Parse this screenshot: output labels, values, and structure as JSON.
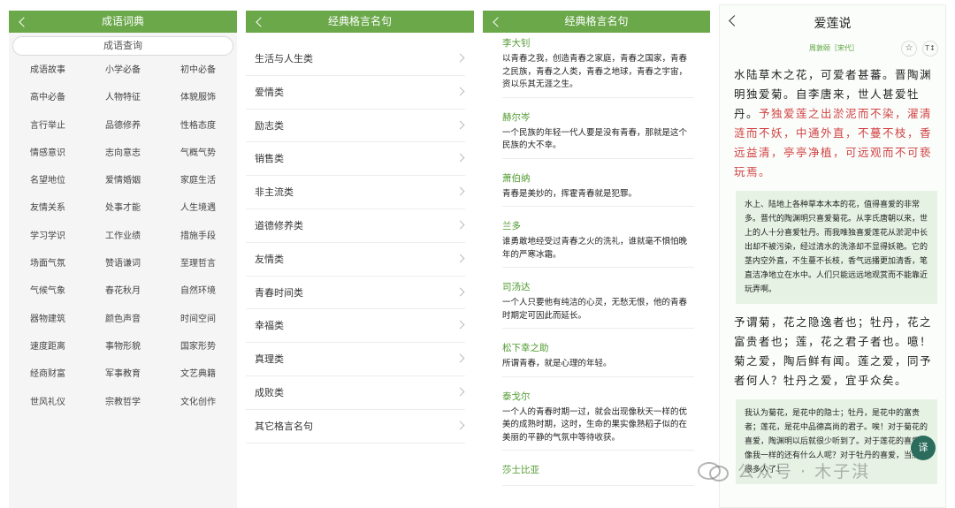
{
  "panel1": {
    "title": "成语词典",
    "search_label": "成语查询",
    "categories": [
      "成语故事",
      "小学必备",
      "初中必备",
      "高中必备",
      "人物特征",
      "体貌服饰",
      "言行举止",
      "品德修养",
      "性格态度",
      "情感意识",
      "志向意志",
      "气概气势",
      "名望地位",
      "爱情婚姻",
      "家庭生活",
      "友情关系",
      "处事才能",
      "人生境遇",
      "学习学识",
      "工作业绩",
      "措施手段",
      "场面气氛",
      "赞语谦词",
      "至理哲言",
      "气候气象",
      "春花秋月",
      "自然环境",
      "器物建筑",
      "颜色声音",
      "时间空间",
      "速度距离",
      "事物形貌",
      "国家形势",
      "经商财富",
      "军事教育",
      "文艺典籍",
      "世风礼仪",
      "宗教哲学",
      "文化创作"
    ]
  },
  "panel2": {
    "title": "经典格言名句",
    "categories": [
      "生活与人生类",
      "爱情类",
      "励志类",
      "销售类",
      "非主流类",
      "道德修养类",
      "友情类",
      "青春时间类",
      "幸福类",
      "真理类",
      "成败类",
      "其它格言名句"
    ]
  },
  "panel3": {
    "title": "经典格言名句",
    "quotes": [
      {
        "author": "李大钊",
        "text": "以青春之我，创造青春之家庭，青春之国家，青春之民族，青春之人类，青春之地球，青春之宇宙，资以乐其无涯之生。"
      },
      {
        "author": "赫尔岑",
        "text": "一个民族的年轻一代人要是没有青春，那就是这个民族的大不幸。"
      },
      {
        "author": "萧伯纳",
        "text": "青春是美妙的，挥霍青春就是犯罪。"
      },
      {
        "author": "兰多",
        "text": "谁勇敢地经受过青春之火的洗礼，谁就毫不惧怕晚年的严寒冰霜。"
      },
      {
        "author": "司汤达",
        "text": "一个人只要他有纯洁的心灵，无愁无恨，他的青春时期定可因此而延长。"
      },
      {
        "author": "松下幸之助",
        "text": "所谓青春，就是心理的年轻。"
      },
      {
        "author": "泰戈尔",
        "text": "一个人的青春时期一过，就会出现像秋天一样的优美的成熟时期，这时，生命的果实像熟稻子似的在美丽的平静的气氛中等待收获。"
      },
      {
        "author": "莎士比亚",
        "text": ""
      }
    ]
  },
  "panel4": {
    "title": "爱莲说",
    "author": "周敦颐［宋代］",
    "star_icon": "star-icon",
    "font_button": "T↕",
    "poem_part1": "水陆草木之花，可爱者甚蕃。晋陶渊明独爱菊。自李唐来，世人甚爱牡丹。",
    "poem_part1_red": "予独爱莲之出淤泥而不染，濯清涟而不妖，中通外直，不蔓不枝，香远益清，亭亭净植，可远观而不可亵玩焉。",
    "translation1": "水上、陆地上各种草本木本的花，值得喜爱的非常多。晋代的陶渊明只喜爱菊花。从李氏唐朝以来，世上的人十分喜爱牡丹。而我唯独喜爱莲花从淤泥中长出却不被污染，经过清水的洗涤却不显得妖艳。它的茎内空外直，不生蔓不长枝，香气远播更加清香，笔直洁净地立在水中。人们只能远远地观赏而不能靠近玩弄啊。",
    "poem_part2": "予谓菊，花之隐逸者也；牡丹，花之富贵者也；莲，花之君子者也。噫！菊之爱，陶后鲜有闻。莲之爱，同予者何人？牡丹之爱，宜乎众矣。",
    "translation2": "我认为菊花，是花中的隐士；牡丹，是花中的富贵者；莲花，是花中品德高尚的君子。唉！对于菊花的喜爱，陶渊明以后就很少听到了。对于莲花的喜爱，像我一样的还有什么人呢？对于牡丹的喜爱，当然就很多人了！",
    "translate_button": "译"
  },
  "watermark": "公众号 · 木子淇",
  "colors": {
    "header_green": "#6aa84a",
    "author_green": "#4f9a2f",
    "poem_red": "#d04343",
    "translation_bg": "#e6f3e4",
    "fab": "#2b6c5c"
  }
}
